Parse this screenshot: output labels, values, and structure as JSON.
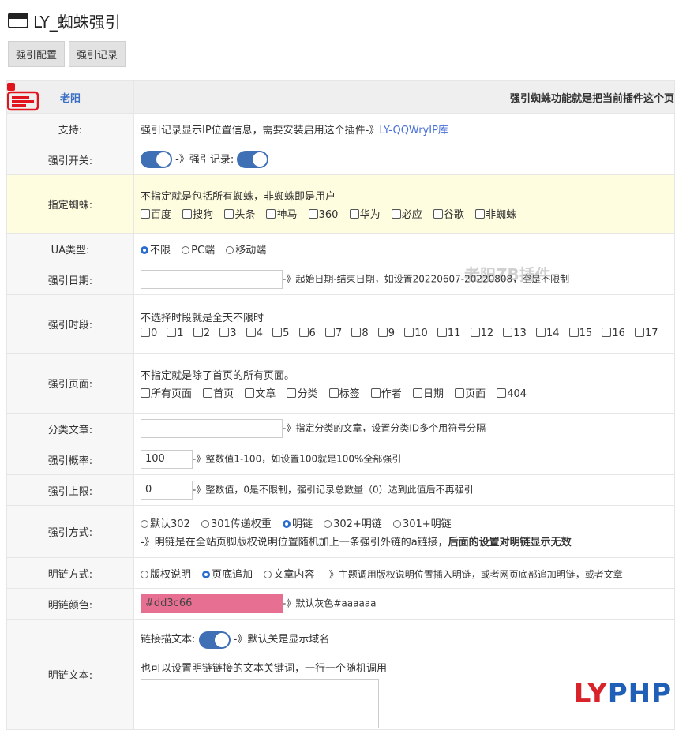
{
  "window": {
    "title": "LY_蜘蛛强引",
    "icon": "window-icon"
  },
  "tabs": [
    "强引配置",
    "强引记录"
  ],
  "header": {
    "author": "老阳",
    "desc": "强引蜘蛛功能就是把当前插件这个页"
  },
  "rows": {
    "support": {
      "label": "支持:",
      "text": "强引记录显示IP位置信息，需要安装启用这个插件-》",
      "link": "LY-QQWryIP库"
    },
    "switch": {
      "label": "强引开关:",
      "mid": "-》强引记录:"
    },
    "spider": {
      "label": "指定蜘蛛:",
      "hint": "不指定就是包括所有蜘蛛，非蜘蛛即是用户",
      "options": [
        "百度",
        "搜狗",
        "头条",
        "神马",
        "360",
        "华为",
        "必应",
        "谷歌",
        "非蜘蛛"
      ]
    },
    "ua": {
      "label": "UA类型:",
      "options": [
        "不限",
        "PC端",
        "移动端"
      ],
      "selected": "不限"
    },
    "date": {
      "label": "强引日期:",
      "value": "",
      "desc": "-》起始日期-结束日期，如设置20220607-20220808，空是不限制"
    },
    "time": {
      "label": "强引时段:",
      "hint": "不选择时段就是全天不限时",
      "options": [
        "0",
        "1",
        "2",
        "3",
        "4",
        "5",
        "6",
        "7",
        "8",
        "9",
        "10",
        "11",
        "12",
        "13",
        "14",
        "15",
        "16",
        "17"
      ]
    },
    "page": {
      "label": "强引页面:",
      "hint": "不指定就是除了首页的所有页面。",
      "options": [
        "所有页面",
        "首页",
        "文章",
        "分类",
        "标签",
        "作者",
        "日期",
        "页面",
        "404"
      ]
    },
    "category": {
      "label": "分类文章:",
      "value": "",
      "desc": "-》指定分类的文章，设置分类ID多个用符号分隔"
    },
    "prob": {
      "label": "强引概率:",
      "value": "100",
      "desc": "-》整数值1-100，如设置100就是100%全部强引"
    },
    "limit": {
      "label": "强引上限:",
      "value": "0",
      "desc": "-》整数值，0是不限制，强引记录总数量（0）达到此值后不再强引"
    },
    "method": {
      "label": "强引方式:",
      "options": [
        "默认302",
        "301传递权重",
        "明链",
        "302+明链",
        "301+明链"
      ],
      "selected": "明链",
      "note": "-》明链是在全站页脚版权说明位置随机加上一条强引外链的a链接，",
      "note_bold": "后面的设置对明链显示无效"
    },
    "linkmode": {
      "label": "明链方式:",
      "options": [
        "版权说明",
        "页底追加",
        "文章内容"
      ],
      "selected": "页底追加",
      "desc": "-》主题调用版权说明位置插入明链，或者网页底部追加明链，或者文章"
    },
    "color": {
      "label": "明链颜色:",
      "value": "#dd3c66",
      "desc": "-》默认灰色#aaaaaa"
    },
    "linktext": {
      "label": "明链文本:",
      "anchor_label": "链接描文本:",
      "anchor_desc": "-》默认关是显示域名",
      "hint": "也可以设置明链链接的文本关键词，一行一个随机调用"
    }
  },
  "watermark": "老阳ZB插件",
  "brand": {
    "ly": "LY",
    "php": "PHP"
  },
  "colors": {
    "accent": "#3f6fb4",
    "link": "#4a6fd8",
    "highlight": "#fffde0",
    "swatch": "#e76f91"
  }
}
